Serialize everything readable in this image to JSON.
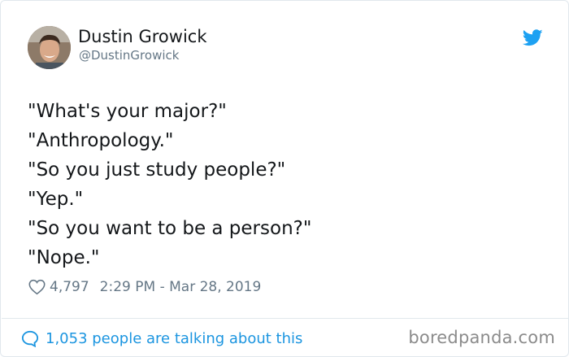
{
  "author": {
    "display_name": "Dustin Growick",
    "handle": "@DustinGrowick"
  },
  "tweet": {
    "lines": [
      "\"What's your major?\"",
      "\"Anthropology.\"",
      "\"So you just study people?\"",
      "\"Yep.\"",
      "\"So you want to be a person?\"",
      "\"Nope.\""
    ],
    "likes": "4,797",
    "timestamp": "2:29 PM - Mar 28, 2019"
  },
  "footer": {
    "talking_text": "1,053 people are talking about this"
  },
  "watermark": "boredpanda.com",
  "icons": {
    "brand": "twitter-bird-icon",
    "like": "heart-icon",
    "reply": "speech-bubble-icon"
  },
  "colors": {
    "twitter_blue": "#1da1f2",
    "link_blue": "#1b95e0",
    "muted_gray": "#657786",
    "text": "#14171a",
    "border": "#e1e8ed"
  }
}
